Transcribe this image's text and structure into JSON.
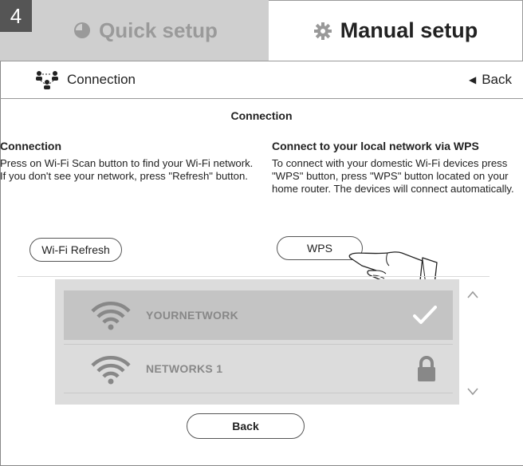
{
  "step_number": "4",
  "tabs": {
    "quick": {
      "label": "Quick setup",
      "icon": "clock-icon"
    },
    "manual": {
      "label": "Manual setup",
      "icon": "gear-icon"
    }
  },
  "breadcrumb": {
    "label": "Connection",
    "icon": "network-users-icon"
  },
  "header_back": "Back",
  "section_title": "Connection",
  "left": {
    "heading": "Connection",
    "text": "Press on Wi-Fi Scan button to find your Wi-Fi network. If you don't see your network, press \"Refresh\" button.",
    "button": "Wi-Fi Refresh"
  },
  "right": {
    "heading": "Connect to your local network via WPS",
    "text": "To connect with your domestic Wi-Fi devices press \"WPS\" button, press \"WPS\" button located on your home router. The devices will connect automatically.",
    "button": "WPS"
  },
  "networks": [
    {
      "ssid": "YOURNETWORK",
      "status_icon": "check-icon",
      "selected": true
    },
    {
      "ssid": "NETWORKS 1",
      "status_icon": "lock-icon",
      "selected": false
    }
  ],
  "bottom_back": "Back",
  "colors": {
    "quick_tab_bg": "#cfcfcf",
    "list_bg": "#dcdcdc",
    "selected_row_bg": "#c4c4c4",
    "muted_text": "#888888"
  }
}
